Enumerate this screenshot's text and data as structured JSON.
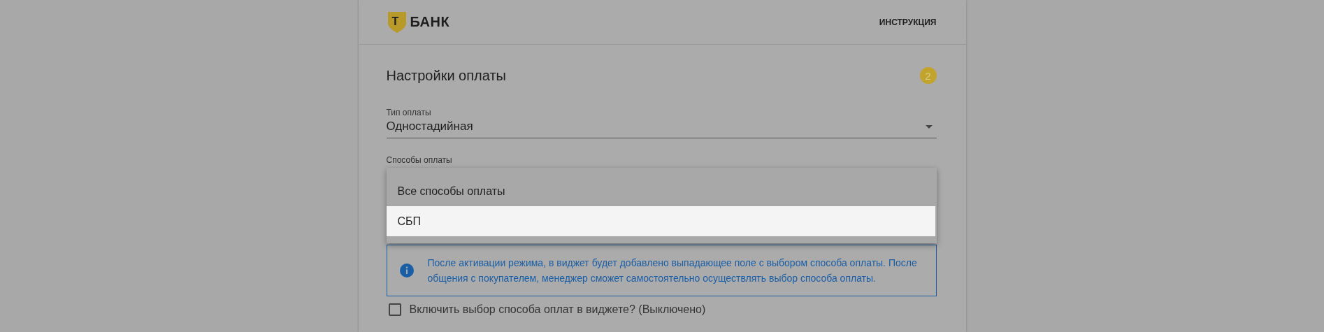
{
  "header": {
    "logo_mark": "Т",
    "logo_text": "БАНК",
    "link": "ИНСТРУКЦИЯ"
  },
  "section": {
    "title": "Настройки оплаты",
    "step": "2"
  },
  "payment_type": {
    "label": "Тип оплаты",
    "value": "Одностадийная"
  },
  "payment_methods": {
    "label": "Способы оплаты",
    "options": [
      {
        "label": "Все способы оплаты",
        "selected": false
      },
      {
        "label": "СБП",
        "selected": true
      }
    ]
  },
  "info": {
    "text": "После активации режима, в виджет будет добавлено выпадающее поле с выбором способа оплаты. После общения с покупателем, менеджер сможет самостоятельно осуществлять выбор способа оплаты."
  },
  "checkbox": {
    "label": "Включить выбор способа оплат в виджете? (Выключено)",
    "checked": false
  }
}
